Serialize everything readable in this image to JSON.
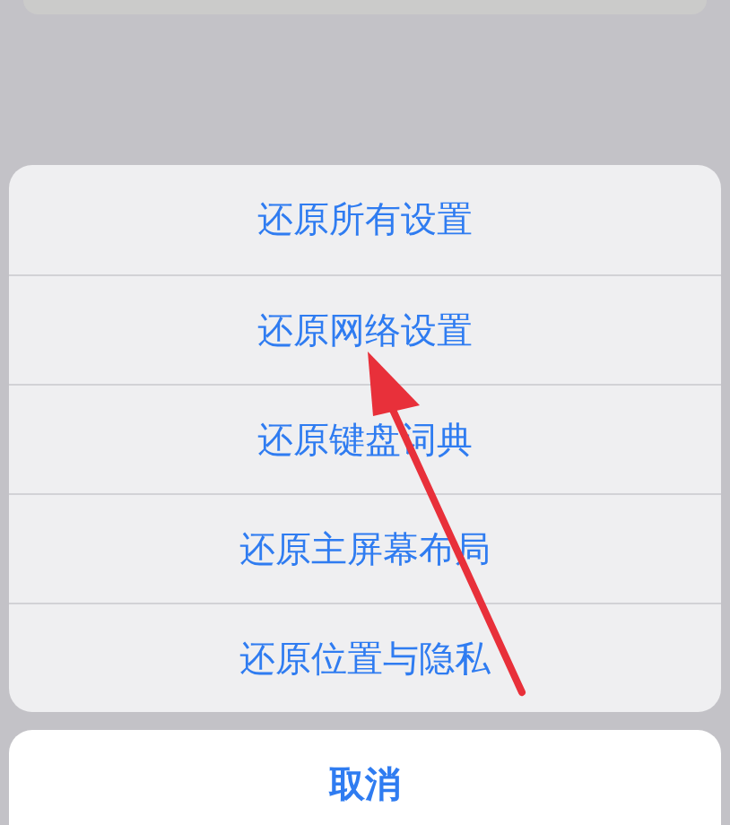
{
  "action_sheet": {
    "options": [
      {
        "label": "还原所有设置"
      },
      {
        "label": "还原网络设置"
      },
      {
        "label": "还原键盘词典"
      },
      {
        "label": "还原主屏幕布局"
      },
      {
        "label": "还原位置与隐私"
      }
    ]
  },
  "cancel_button": {
    "label": "取消"
  }
}
